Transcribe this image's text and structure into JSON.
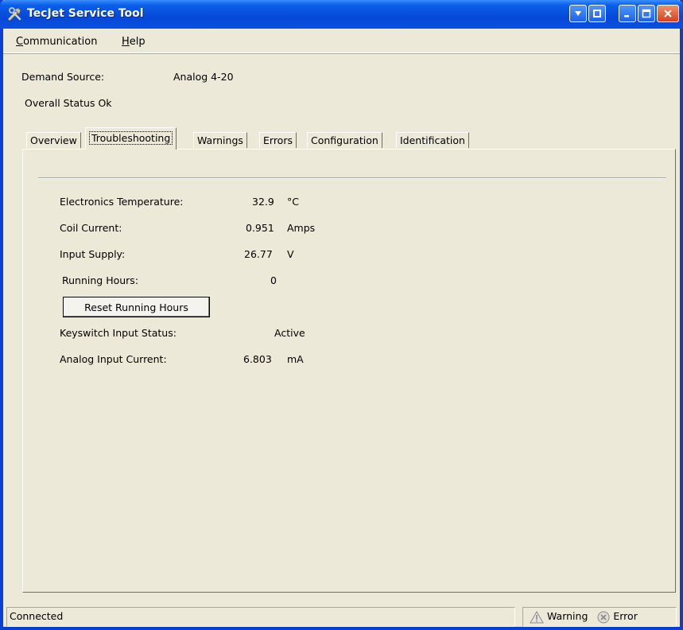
{
  "window": {
    "title": "TecJet Service Tool"
  },
  "menu": [
    {
      "mnemonic": "C",
      "rest": "ommunication"
    },
    {
      "mnemonic": "H",
      "rest": "elp"
    }
  ],
  "header": {
    "demand_source_label": "Demand Source:",
    "demand_source_value": "Analog 4-20",
    "overall_status": "Overall Status Ok"
  },
  "tabs": [
    "Overview",
    "Troubleshooting",
    "Warnings",
    "Errors",
    "Configuration",
    "Identification"
  ],
  "active_tab": "Troubleshooting",
  "troubleshooting": {
    "rows": [
      {
        "label": "Electronics Temperature:",
        "value": "32.9",
        "unit": "°C"
      },
      {
        "label": "Coil Current:",
        "value": "0.951",
        "unit": "Amps"
      },
      {
        "label": "Input Supply:",
        "value": "26.77",
        "unit": "V"
      },
      {
        "label": "Running Hours:",
        "value": "0",
        "unit": ""
      }
    ],
    "reset_button": "Reset Running Hours",
    "keyswitch_label": "Keyswitch Input Status:",
    "keyswitch_value": "Active",
    "analog_label": "Analog Input Current:",
    "analog_value": "6.803",
    "analog_unit": "mA"
  },
  "status": {
    "connection": "Connected",
    "warning": "Warning",
    "error": "Error"
  },
  "colors": {
    "titlebar": "#0648d8",
    "window_bg": "#ece9d8"
  }
}
